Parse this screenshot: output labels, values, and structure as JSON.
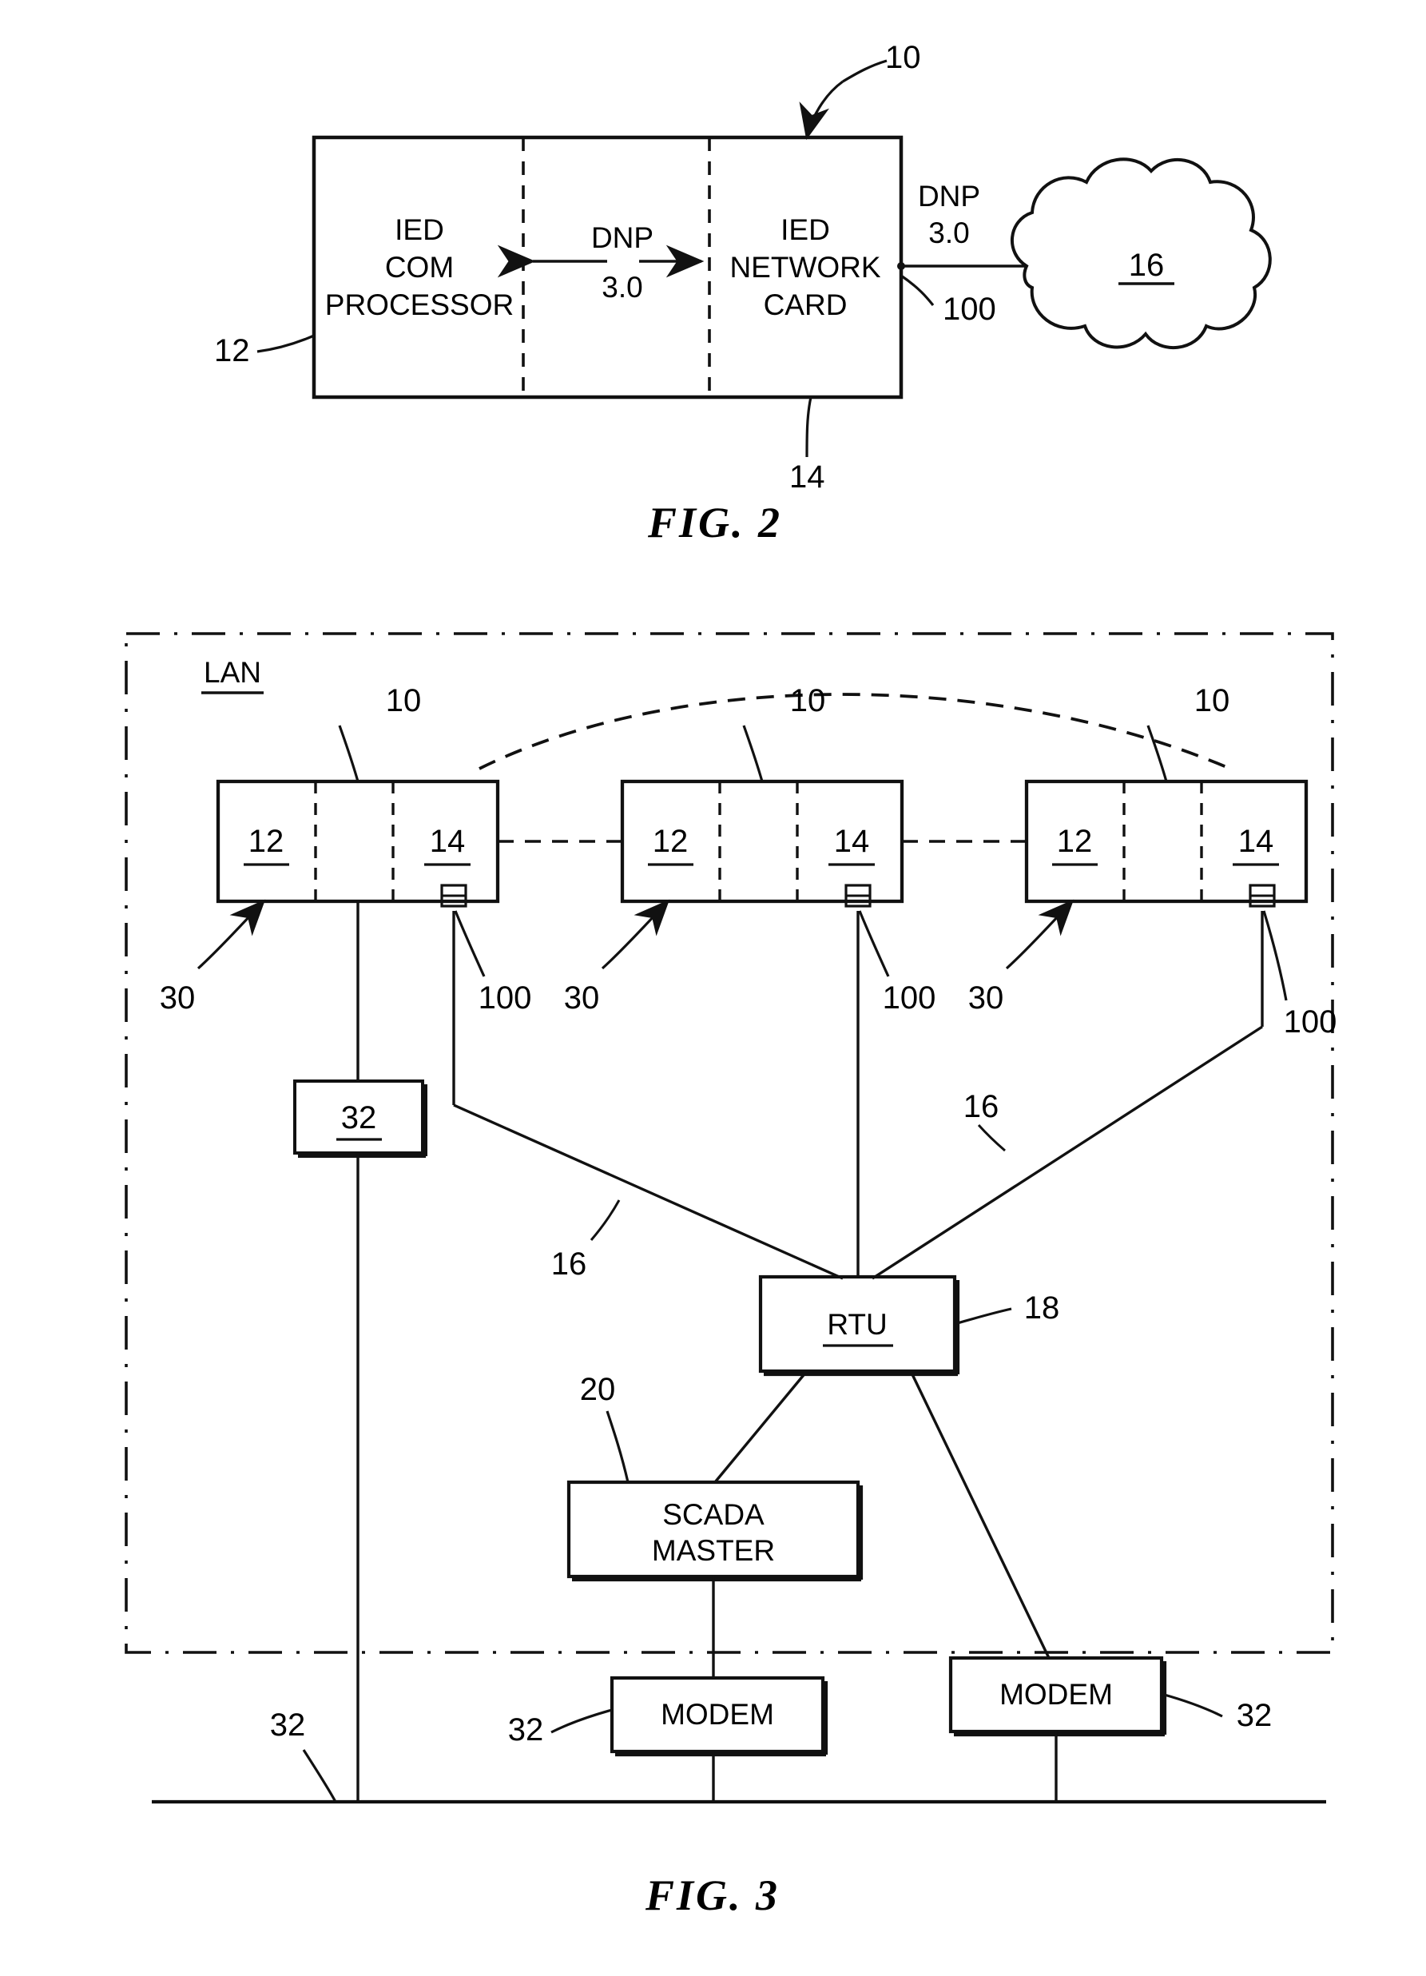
{
  "sheet": {
    "background": "#ffffff",
    "ink": "#111111"
  },
  "figures": [
    {
      "id": "fig2",
      "caption": "FIG.  2",
      "description": "IED block diagram connected to a network cloud via DNP 3.0",
      "blocks": [
        {
          "id": "ied-com-processor",
          "lines": [
            "IED",
            "COM",
            "PROCESSOR"
          ]
        },
        {
          "id": "ied-network-card",
          "lines": [
            "IED",
            "NETWORK",
            "CARD"
          ]
        }
      ],
      "protocol_internal": {
        "line1": "DNP",
        "line2": "3.0"
      },
      "protocol_external": {
        "line1": "DNP",
        "line2": "3.0"
      },
      "cloud_label": "16",
      "ref_numerals": {
        "assembly": "10",
        "com_processor": "12",
        "network_card": "14",
        "port": "100"
      }
    },
    {
      "id": "fig3",
      "caption": "FIG.  3",
      "description": "LAN with three IED devices connected through an RTU to a SCADA master and modems",
      "lan_label": "LAN",
      "devices": [
        {
          "id": "device-1",
          "left_label": "12",
          "right_label": "14",
          "assembly_ref": "10",
          "device_ref": "30",
          "port_ref": "100"
        },
        {
          "id": "device-2",
          "left_label": "12",
          "right_label": "14",
          "assembly_ref": "10",
          "device_ref": "30",
          "port_ref": "100"
        },
        {
          "id": "device-3",
          "left_label": "12",
          "right_label": "14",
          "assembly_ref": "10",
          "device_ref": "30",
          "port_ref": "100"
        }
      ],
      "boxes": [
        {
          "id": "box-32",
          "label": "32",
          "underlined": true
        },
        {
          "id": "box-rtu",
          "label": "RTU",
          "underlined": true,
          "ref": "18"
        },
        {
          "id": "box-scada-master",
          "line1": "SCADA",
          "line2": "MASTER",
          "ref": "20"
        },
        {
          "id": "box-modem-left",
          "label": "MODEM",
          "ref": "32"
        },
        {
          "id": "box-modem-right",
          "label": "MODEM",
          "ref": "32"
        }
      ],
      "link_refs": {
        "left": "16",
        "right": "16"
      },
      "bus_ref": "32"
    }
  ]
}
